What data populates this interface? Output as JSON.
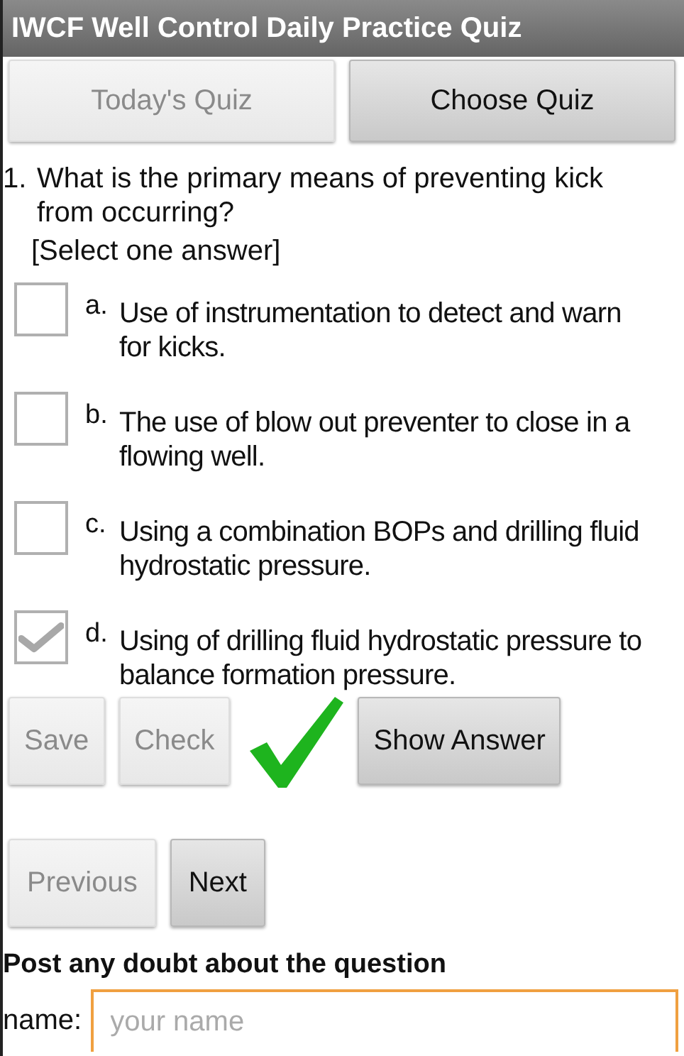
{
  "window": {
    "title": "IWCF Well Control Daily Practice Quiz"
  },
  "tabs": [
    {
      "label": "Today's Quiz",
      "disabled": true
    },
    {
      "label": "Choose Quiz",
      "disabled": false
    }
  ],
  "question": {
    "number": "1.",
    "text": "What is the primary means of preventing kick from occurring?",
    "instruction": "[Select one answer]"
  },
  "options": [
    {
      "letter": "a.",
      "text": "Use of instrumentation to detect and warn for kicks.",
      "checked": false
    },
    {
      "letter": "b.",
      "text": "The use of blow out preventer to close in a flowing well.",
      "checked": false
    },
    {
      "letter": "c.",
      "text": "Using a combination BOPs and drilling fluid hydrostatic pressure.",
      "checked": false
    },
    {
      "letter": "d.",
      "text": "Using of drilling fluid hydrostatic pressure to balance formation pressure.",
      "checked": true
    }
  ],
  "actions": [
    {
      "label": "Save",
      "disabled": true
    },
    {
      "label": "Check",
      "disabled": true
    },
    {
      "label": "Show Answer",
      "disabled": false
    }
  ],
  "answer_correct": true,
  "navigation": [
    {
      "label": "Previous",
      "disabled": true
    },
    {
      "label": "Next",
      "disabled": false
    }
  ],
  "comment": {
    "heading": "Post any doubt about the question",
    "name_label": "name:",
    "name_placeholder": "your name"
  }
}
